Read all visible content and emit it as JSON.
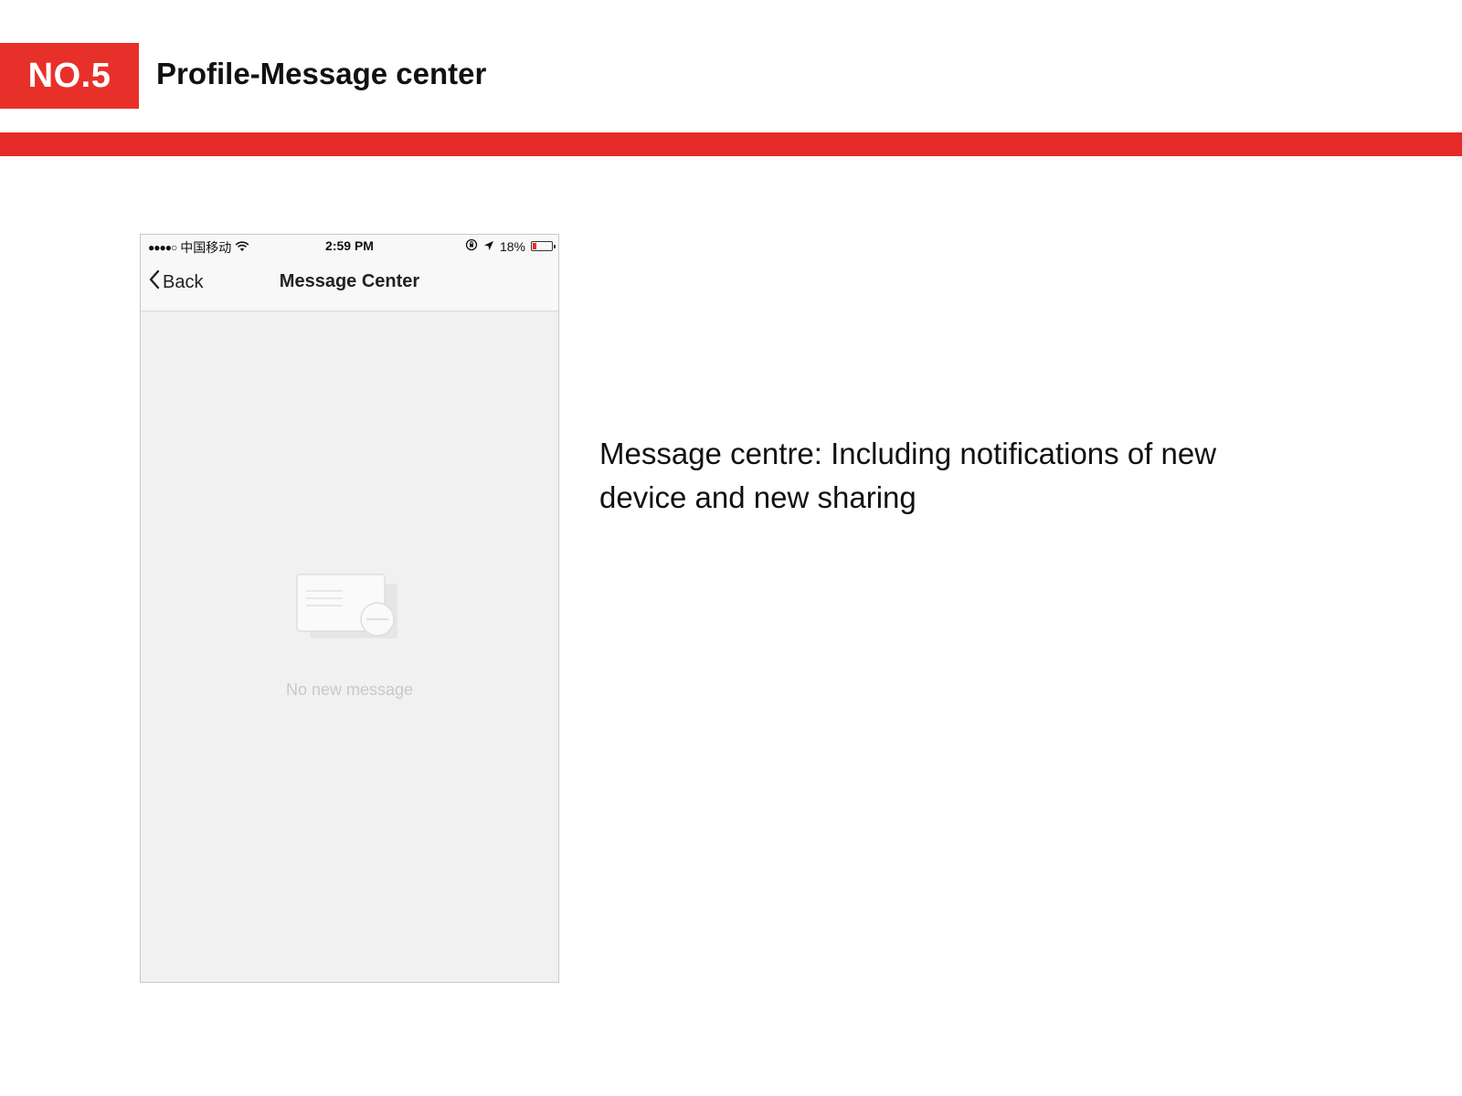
{
  "header": {
    "badge": "NO.5",
    "title": "Profile-Message center",
    "accent_color": "#e8302a"
  },
  "phone": {
    "status_bar": {
      "signal": "●●●●○",
      "carrier": "中国移动",
      "wifi_icon": "wifi-icon",
      "time": "2:59 PM",
      "lock_icon": "rotation-lock-icon",
      "location_icon": "location-arrow-icon",
      "battery_text": "18%",
      "battery_level": 0.18
    },
    "nav": {
      "back_label": "Back",
      "title": "Message Center"
    },
    "empty_state": {
      "icon": "empty-message-icon",
      "text": "No new message"
    }
  },
  "description": "Message centre: Including notifications of new device and new sharing"
}
